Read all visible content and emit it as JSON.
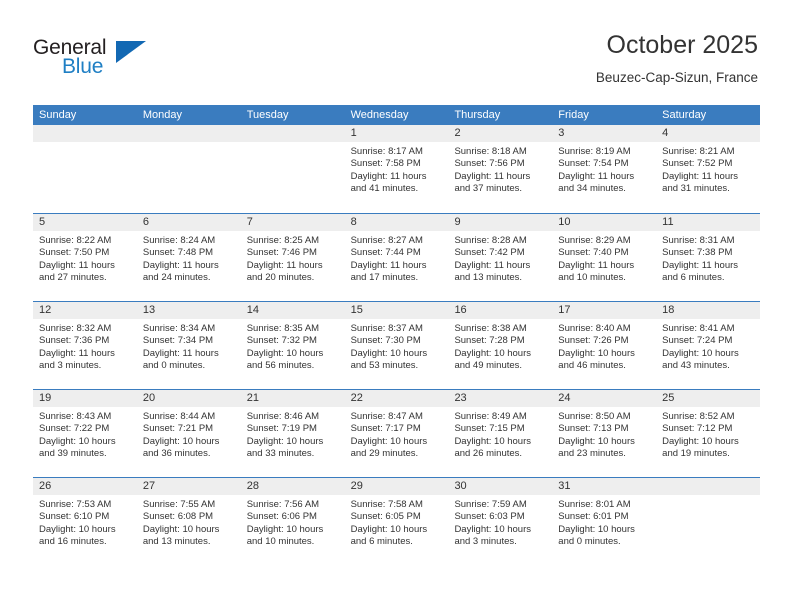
{
  "brand": {
    "name_part1": "General",
    "name_part2": "Blue"
  },
  "header": {
    "title": "October 2025",
    "subtitle": "Beuzec-Cap-Sizun, France"
  },
  "colors": {
    "header_blue": "#3a7cbf",
    "logo_blue": "#1268b3",
    "band_gray": "#eeeeee"
  },
  "weekdays": [
    "Sunday",
    "Monday",
    "Tuesday",
    "Wednesday",
    "Thursday",
    "Friday",
    "Saturday"
  ],
  "weeks": [
    [
      {
        "day": "",
        "sunrise": "",
        "sunset": "",
        "daylight": "",
        "daylight2": ""
      },
      {
        "day": "",
        "sunrise": "",
        "sunset": "",
        "daylight": "",
        "daylight2": ""
      },
      {
        "day": "",
        "sunrise": "",
        "sunset": "",
        "daylight": "",
        "daylight2": ""
      },
      {
        "day": "1",
        "sunrise": "Sunrise: 8:17 AM",
        "sunset": "Sunset: 7:58 PM",
        "daylight": "Daylight: 11 hours",
        "daylight2": "and 41 minutes."
      },
      {
        "day": "2",
        "sunrise": "Sunrise: 8:18 AM",
        "sunset": "Sunset: 7:56 PM",
        "daylight": "Daylight: 11 hours",
        "daylight2": "and 37 minutes."
      },
      {
        "day": "3",
        "sunrise": "Sunrise: 8:19 AM",
        "sunset": "Sunset: 7:54 PM",
        "daylight": "Daylight: 11 hours",
        "daylight2": "and 34 minutes."
      },
      {
        "day": "4",
        "sunrise": "Sunrise: 8:21 AM",
        "sunset": "Sunset: 7:52 PM",
        "daylight": "Daylight: 11 hours",
        "daylight2": "and 31 minutes."
      }
    ],
    [
      {
        "day": "5",
        "sunrise": "Sunrise: 8:22 AM",
        "sunset": "Sunset: 7:50 PM",
        "daylight": "Daylight: 11 hours",
        "daylight2": "and 27 minutes."
      },
      {
        "day": "6",
        "sunrise": "Sunrise: 8:24 AM",
        "sunset": "Sunset: 7:48 PM",
        "daylight": "Daylight: 11 hours",
        "daylight2": "and 24 minutes."
      },
      {
        "day": "7",
        "sunrise": "Sunrise: 8:25 AM",
        "sunset": "Sunset: 7:46 PM",
        "daylight": "Daylight: 11 hours",
        "daylight2": "and 20 minutes."
      },
      {
        "day": "8",
        "sunrise": "Sunrise: 8:27 AM",
        "sunset": "Sunset: 7:44 PM",
        "daylight": "Daylight: 11 hours",
        "daylight2": "and 17 minutes."
      },
      {
        "day": "9",
        "sunrise": "Sunrise: 8:28 AM",
        "sunset": "Sunset: 7:42 PM",
        "daylight": "Daylight: 11 hours",
        "daylight2": "and 13 minutes."
      },
      {
        "day": "10",
        "sunrise": "Sunrise: 8:29 AM",
        "sunset": "Sunset: 7:40 PM",
        "daylight": "Daylight: 11 hours",
        "daylight2": "and 10 minutes."
      },
      {
        "day": "11",
        "sunrise": "Sunrise: 8:31 AM",
        "sunset": "Sunset: 7:38 PM",
        "daylight": "Daylight: 11 hours",
        "daylight2": "and 6 minutes."
      }
    ],
    [
      {
        "day": "12",
        "sunrise": "Sunrise: 8:32 AM",
        "sunset": "Sunset: 7:36 PM",
        "daylight": "Daylight: 11 hours",
        "daylight2": "and 3 minutes."
      },
      {
        "day": "13",
        "sunrise": "Sunrise: 8:34 AM",
        "sunset": "Sunset: 7:34 PM",
        "daylight": "Daylight: 11 hours",
        "daylight2": "and 0 minutes."
      },
      {
        "day": "14",
        "sunrise": "Sunrise: 8:35 AM",
        "sunset": "Sunset: 7:32 PM",
        "daylight": "Daylight: 10 hours",
        "daylight2": "and 56 minutes."
      },
      {
        "day": "15",
        "sunrise": "Sunrise: 8:37 AM",
        "sunset": "Sunset: 7:30 PM",
        "daylight": "Daylight: 10 hours",
        "daylight2": "and 53 minutes."
      },
      {
        "day": "16",
        "sunrise": "Sunrise: 8:38 AM",
        "sunset": "Sunset: 7:28 PM",
        "daylight": "Daylight: 10 hours",
        "daylight2": "and 49 minutes."
      },
      {
        "day": "17",
        "sunrise": "Sunrise: 8:40 AM",
        "sunset": "Sunset: 7:26 PM",
        "daylight": "Daylight: 10 hours",
        "daylight2": "and 46 minutes."
      },
      {
        "day": "18",
        "sunrise": "Sunrise: 8:41 AM",
        "sunset": "Sunset: 7:24 PM",
        "daylight": "Daylight: 10 hours",
        "daylight2": "and 43 minutes."
      }
    ],
    [
      {
        "day": "19",
        "sunrise": "Sunrise: 8:43 AM",
        "sunset": "Sunset: 7:22 PM",
        "daylight": "Daylight: 10 hours",
        "daylight2": "and 39 minutes."
      },
      {
        "day": "20",
        "sunrise": "Sunrise: 8:44 AM",
        "sunset": "Sunset: 7:21 PM",
        "daylight": "Daylight: 10 hours",
        "daylight2": "and 36 minutes."
      },
      {
        "day": "21",
        "sunrise": "Sunrise: 8:46 AM",
        "sunset": "Sunset: 7:19 PM",
        "daylight": "Daylight: 10 hours",
        "daylight2": "and 33 minutes."
      },
      {
        "day": "22",
        "sunrise": "Sunrise: 8:47 AM",
        "sunset": "Sunset: 7:17 PM",
        "daylight": "Daylight: 10 hours",
        "daylight2": "and 29 minutes."
      },
      {
        "day": "23",
        "sunrise": "Sunrise: 8:49 AM",
        "sunset": "Sunset: 7:15 PM",
        "daylight": "Daylight: 10 hours",
        "daylight2": "and 26 minutes."
      },
      {
        "day": "24",
        "sunrise": "Sunrise: 8:50 AM",
        "sunset": "Sunset: 7:13 PM",
        "daylight": "Daylight: 10 hours",
        "daylight2": "and 23 minutes."
      },
      {
        "day": "25",
        "sunrise": "Sunrise: 8:52 AM",
        "sunset": "Sunset: 7:12 PM",
        "daylight": "Daylight: 10 hours",
        "daylight2": "and 19 minutes."
      }
    ],
    [
      {
        "day": "26",
        "sunrise": "Sunrise: 7:53 AM",
        "sunset": "Sunset: 6:10 PM",
        "daylight": "Daylight: 10 hours",
        "daylight2": "and 16 minutes."
      },
      {
        "day": "27",
        "sunrise": "Sunrise: 7:55 AM",
        "sunset": "Sunset: 6:08 PM",
        "daylight": "Daylight: 10 hours",
        "daylight2": "and 13 minutes."
      },
      {
        "day": "28",
        "sunrise": "Sunrise: 7:56 AM",
        "sunset": "Sunset: 6:06 PM",
        "daylight": "Daylight: 10 hours",
        "daylight2": "and 10 minutes."
      },
      {
        "day": "29",
        "sunrise": "Sunrise: 7:58 AM",
        "sunset": "Sunset: 6:05 PM",
        "daylight": "Daylight: 10 hours",
        "daylight2": "and 6 minutes."
      },
      {
        "day": "30",
        "sunrise": "Sunrise: 7:59 AM",
        "sunset": "Sunset: 6:03 PM",
        "daylight": "Daylight: 10 hours",
        "daylight2": "and 3 minutes."
      },
      {
        "day": "31",
        "sunrise": "Sunrise: 8:01 AM",
        "sunset": "Sunset: 6:01 PM",
        "daylight": "Daylight: 10 hours",
        "daylight2": "and 0 minutes."
      },
      {
        "day": "",
        "sunrise": "",
        "sunset": "",
        "daylight": "",
        "daylight2": ""
      }
    ]
  ]
}
